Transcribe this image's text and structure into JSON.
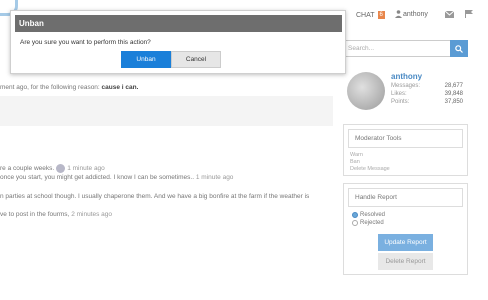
{
  "topnav": {
    "chat_label": "CHAT",
    "chat_badge": "6",
    "username": "anthony"
  },
  "modal": {
    "title": "Unban",
    "message": "Are you sure you want to perform this action?",
    "confirm_label": "Unban",
    "cancel_label": "Cancel"
  },
  "background": {
    "reason_prefix": "ment ago, for the following reason: ",
    "reason_value": "cause i can.",
    "line1_text": "re a couple weeks.",
    "line1_time": "1 minute ago",
    "line2_text": "once you start, you might get addicted. I know I can be sometimes..",
    "line2_time": "1 minute ago",
    "line3_text": "n parties at school though. I usually chaperone them. And we have a big bonfire at the farm if the weather is",
    "line4_text": "ve to post in the fourms,",
    "line4_time": "2 minutes ago"
  },
  "sidebar": {
    "search_placeholder": "Search...",
    "profile": {
      "name": "anthony",
      "stats": [
        {
          "label": "Messages:",
          "value": "28,677"
        },
        {
          "label": "Likes:",
          "value": "39,848"
        },
        {
          "label": "Points:",
          "value": "37,850"
        }
      ]
    },
    "moderator": {
      "title": "Moderator Tools",
      "items": [
        "Warn",
        "Ban",
        "Delete Message"
      ]
    },
    "report": {
      "title": "Handle Report",
      "options": [
        {
          "label": "Resolved",
          "selected": true
        },
        {
          "label": "Rejected",
          "selected": false
        }
      ],
      "update_label": "Update Report",
      "delete_label": "Delete Report"
    }
  }
}
